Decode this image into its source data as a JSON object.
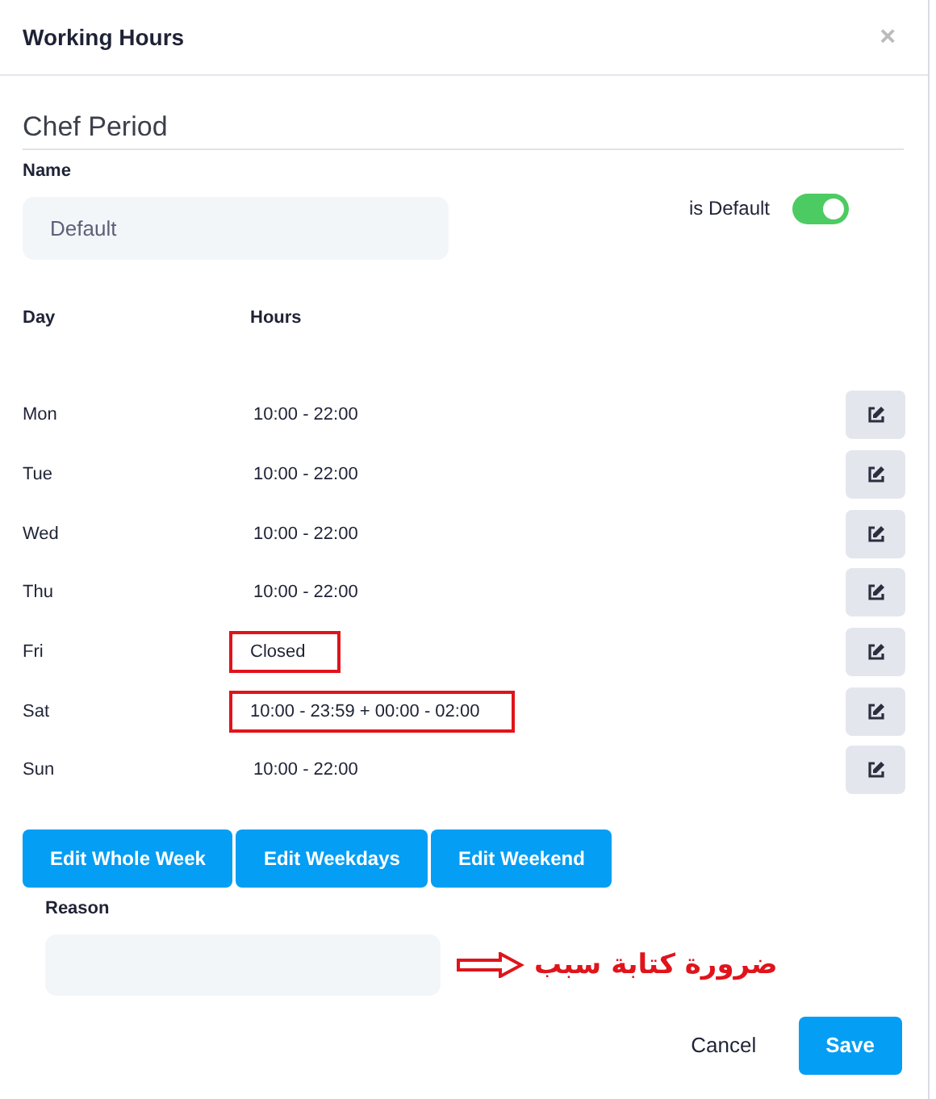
{
  "dialog": {
    "title": "Working Hours",
    "close": "×"
  },
  "section_title": "Chef Period",
  "name_field": {
    "label": "Name",
    "value": "Default"
  },
  "default_toggle": {
    "label": "is Default",
    "on": true
  },
  "columns": [
    "Day",
    "Hours"
  ],
  "days": [
    {
      "day": "Mon",
      "hours": "10:00 - 22:00",
      "highlighted": false
    },
    {
      "day": "Tue",
      "hours": "10:00 - 22:00",
      "highlighted": false
    },
    {
      "day": "Wed",
      "hours": "10:00 - 22:00",
      "highlighted": false
    },
    {
      "day": "Thu",
      "hours": "10:00 - 22:00",
      "highlighted": false
    },
    {
      "day": "Fri",
      "hours": "Closed",
      "highlighted": true
    },
    {
      "day": "Sat",
      "hours": "10:00 - 23:59 + 00:00 - 02:00",
      "highlighted": true
    },
    {
      "day": "Sun",
      "hours": "10:00 - 22:00",
      "highlighted": false
    }
  ],
  "edit_buttons": [
    "Edit Whole Week",
    "Edit Weekdays",
    "Edit Weekend"
  ],
  "reason_field": {
    "label": "Reason"
  },
  "annotation": {
    "text": "ضرورة كتابة سبب"
  },
  "actions": {
    "cancel": "Cancel",
    "save": "Save"
  }
}
